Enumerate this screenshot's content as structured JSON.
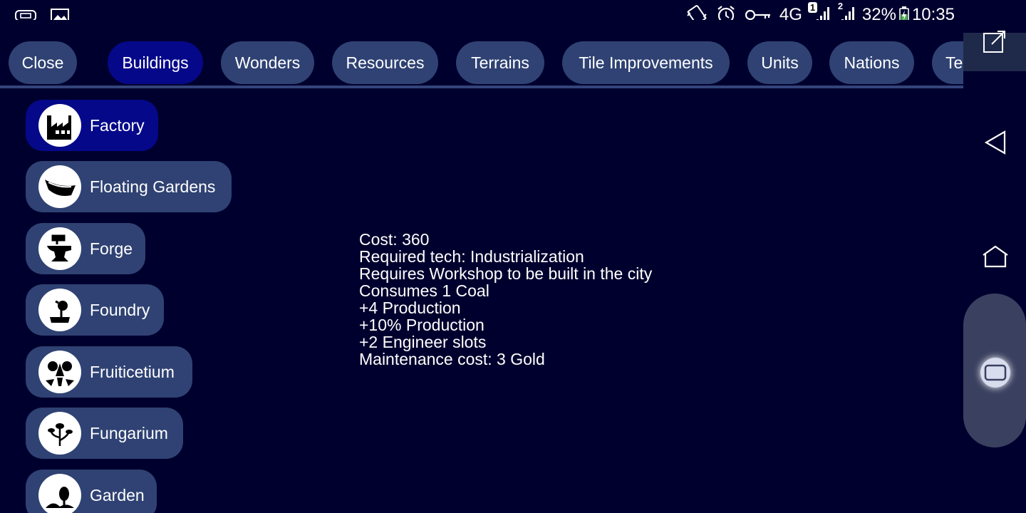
{
  "status_bar": {
    "network": "4G",
    "sim1_badge": "1",
    "sim2_badge": "2",
    "battery": "32%",
    "time": "10:35",
    "icons": [
      "cable-icon",
      "image-icon",
      "vibrate-icon",
      "alarm-icon",
      "key-icon",
      "signal-icon",
      "battery-icon"
    ]
  },
  "tabs": [
    {
      "label": "Close",
      "active": false
    },
    {
      "label": "Buildings",
      "active": true
    },
    {
      "label": "Wonders",
      "active": false
    },
    {
      "label": "Resources",
      "active": false
    },
    {
      "label": "Terrains",
      "active": false
    },
    {
      "label": "Tile Improvements",
      "active": false
    },
    {
      "label": "Units",
      "active": false
    },
    {
      "label": "Nations",
      "active": false
    },
    {
      "label": "Technolog",
      "active": false
    }
  ],
  "buildings": [
    {
      "label": "Factory",
      "icon": "factory-icon",
      "selected": true
    },
    {
      "label": "Floating Gardens",
      "icon": "boat-icon",
      "selected": false
    },
    {
      "label": "Forge",
      "icon": "anvil-icon",
      "selected": false
    },
    {
      "label": "Foundry",
      "icon": "foundry-icon",
      "selected": false
    },
    {
      "label": "Fruiticetium",
      "icon": "fruit-icon",
      "selected": false
    },
    {
      "label": "Fungarium",
      "icon": "mushroom-icon",
      "selected": false
    },
    {
      "label": "Garden",
      "icon": "garden-icon",
      "selected": false
    }
  ],
  "detail": {
    "lines": [
      "Cost: 360",
      "Required tech: Industrialization",
      "Requires Workshop to be built in the city",
      "Consumes 1 Coal",
      "+4 Production",
      "+10% Production",
      "+2 Engineer slots",
      "Maintenance cost: 3 Gold"
    ]
  },
  "nav": {
    "icons": [
      "expand-icon",
      "back-icon",
      "home-icon",
      "recents-icon"
    ]
  },
  "colors": {
    "background": "#00002e",
    "pill": "#2f4273",
    "selected": "#06088a"
  }
}
